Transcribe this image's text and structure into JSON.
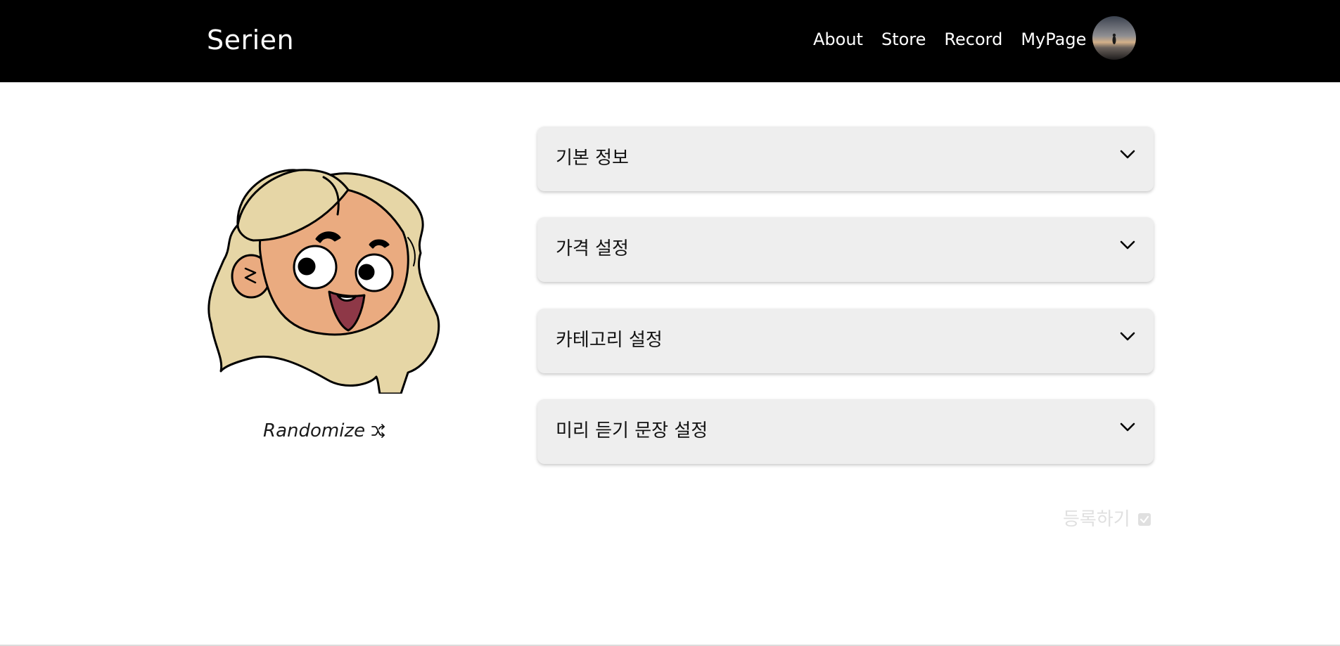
{
  "header": {
    "brand": "Serien",
    "nav": [
      {
        "label": "About"
      },
      {
        "label": "Store"
      },
      {
        "label": "Record"
      },
      {
        "label": "MyPage"
      }
    ]
  },
  "profile": {
    "randomize_label": "Randomize",
    "randomize_icon": "shuffle-icon",
    "character_icon": "cartoon-avatar"
  },
  "sections": [
    {
      "label": "기본 정보"
    },
    {
      "label": "가격 설정"
    },
    {
      "label": "카테고리 설정"
    },
    {
      "label": "미리 듣기 문장 설정"
    }
  ],
  "submit": {
    "label": "등록하기",
    "icon": "check-square-icon",
    "color": "#e0e0e0"
  },
  "colors": {
    "header_bg": "#000000",
    "accordion_bg": "#eeeeee",
    "hair": "#e6d6a6",
    "skin": "#eaab80",
    "tongue": "#8e3847"
  }
}
